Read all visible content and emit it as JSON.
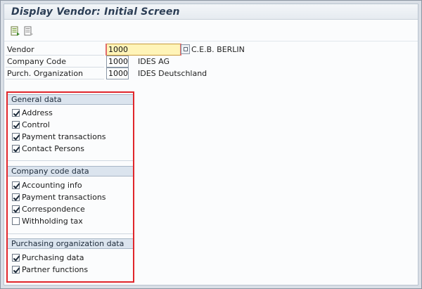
{
  "window": {
    "title": "Display Vendor:  Initial Screen"
  },
  "toolbar": {
    "buttons": [
      {
        "icon": "document-green-icon"
      },
      {
        "icon": "document-list-icon"
      }
    ]
  },
  "header_fields": {
    "vendor": {
      "label": "Vendor",
      "value": "1000",
      "description": "C.E.B. BERLIN"
    },
    "company_code": {
      "label": "Company Code",
      "value": "1000",
      "description": "IDES AG"
    },
    "purch_org": {
      "label": "Purch. Organization",
      "value": "1000",
      "description": "IDES Deutschland"
    }
  },
  "groups": {
    "general": {
      "title": "General data",
      "items": [
        {
          "label": "Address",
          "checked": true
        },
        {
          "label": "Control",
          "checked": true
        },
        {
          "label": "Payment transactions",
          "checked": true
        },
        {
          "label": "Contact Persons",
          "checked": true
        }
      ]
    },
    "company": {
      "title": "Company code data",
      "items": [
        {
          "label": "Accounting info",
          "checked": true
        },
        {
          "label": "Payment transactions",
          "checked": true
        },
        {
          "label": "Correspondence",
          "checked": true
        },
        {
          "label": "Withholding tax",
          "checked": false
        }
      ]
    },
    "purchasing": {
      "title": "Purchasing organization data",
      "items": [
        {
          "label": "Purchasing data",
          "checked": true
        },
        {
          "label": "Partner functions",
          "checked": true
        }
      ]
    }
  },
  "colors": {
    "highlight_border": "#e0262b",
    "active_field": "#fff4b8",
    "group_header": "#dbe4ee"
  }
}
